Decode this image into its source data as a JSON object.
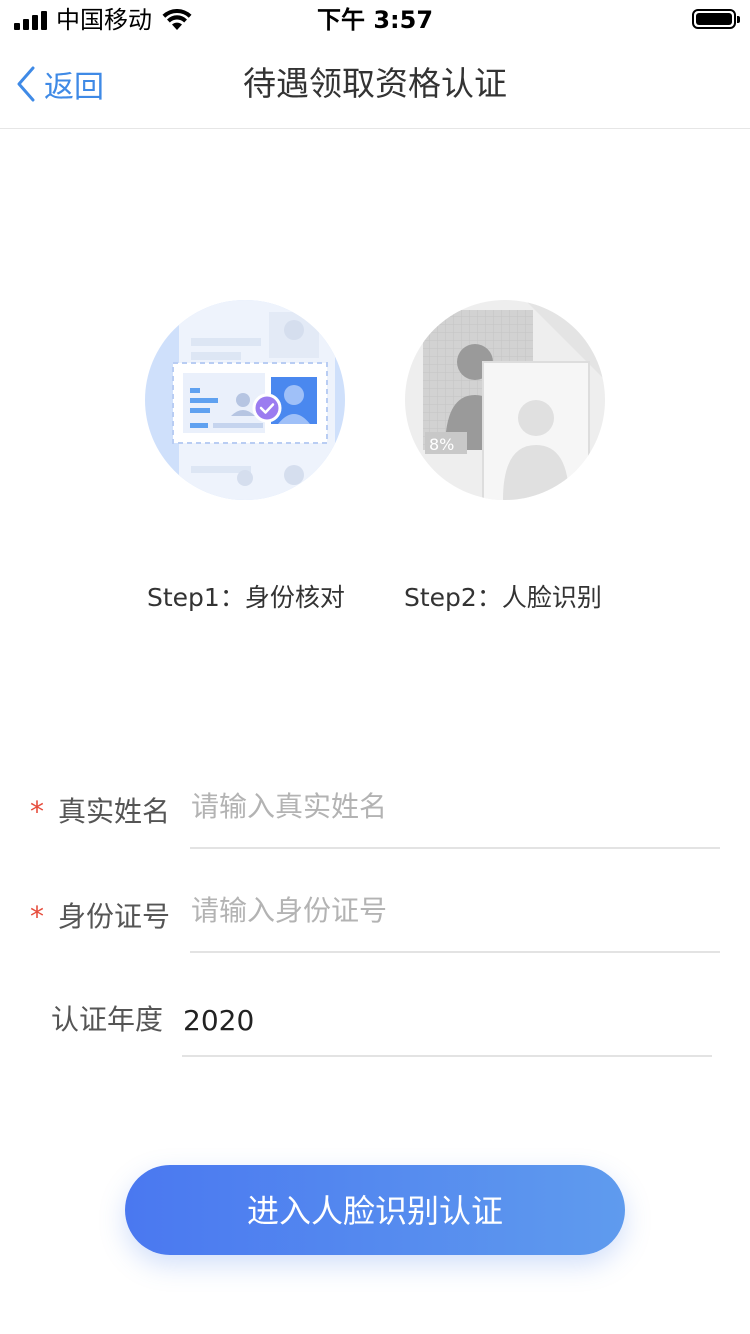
{
  "status_bar": {
    "carrier": "中国移动",
    "time": "下午 3:57",
    "icons": [
      "signal-icon",
      "wifi-icon",
      "battery-icon"
    ]
  },
  "nav": {
    "back_label": "返回",
    "title": "待遇领取资格认证",
    "back_icon": "chevron-left-icon"
  },
  "steps": [
    {
      "label": "Step1：身份核对",
      "image": "id-card-verify-illustration",
      "percent_text": ""
    },
    {
      "label": "Step2：人脸识别",
      "image": "face-recognition-illustration",
      "percent_text": "8%"
    }
  ],
  "form": {
    "name": {
      "label": "真实姓名",
      "placeholder": "请输入真实姓名",
      "required": true,
      "value": ""
    },
    "id_number": {
      "label": "身份证号",
      "placeholder": "请输入身份证号",
      "required": true,
      "value": ""
    },
    "year": {
      "label": "认证年度",
      "value": "2020",
      "required": false
    },
    "required_mark": "*"
  },
  "submit_label": "进入人脸识别认证",
  "colors": {
    "accent": "#3f8ae6",
    "button_start": "#4a78f0",
    "button_end": "#5f9bee",
    "required": "#e64c3c",
    "check_badge": "#9b7cf0"
  }
}
